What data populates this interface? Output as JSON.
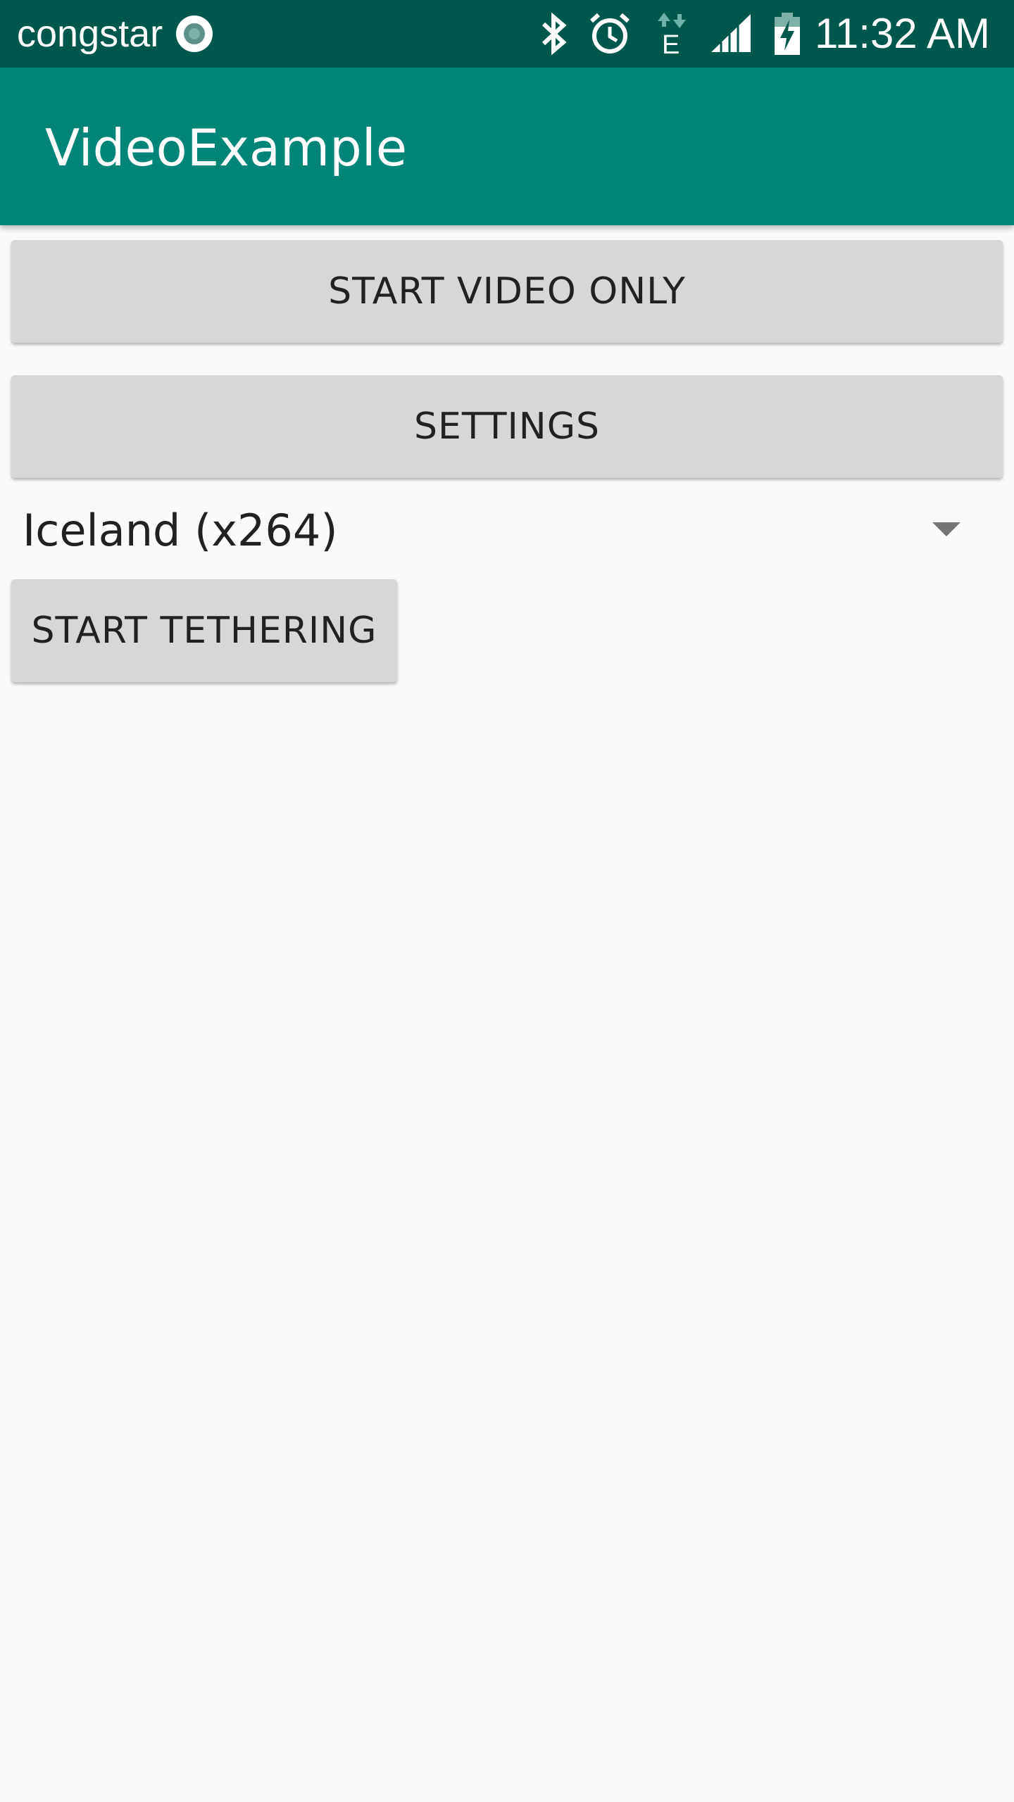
{
  "status_bar": {
    "carrier": "congstar",
    "network_type": "E",
    "time": "11:32 AM",
    "icons": [
      "carrier-ring-icon",
      "bluetooth-icon",
      "alarm-icon",
      "data-arrows-icon",
      "signal-icon",
      "battery-charging-icon"
    ]
  },
  "app_bar": {
    "title": "VideoExample"
  },
  "main": {
    "start_video_label": "START VIDEO ONLY",
    "settings_label": "SETTINGS",
    "spinner_selected": "Iceland (x264)",
    "start_tethering_label": "START TETHERING"
  },
  "colors": {
    "status_bar": "#00584c",
    "app_bar": "#008577",
    "button": "#d6d7d7",
    "background": "#fafafa"
  }
}
